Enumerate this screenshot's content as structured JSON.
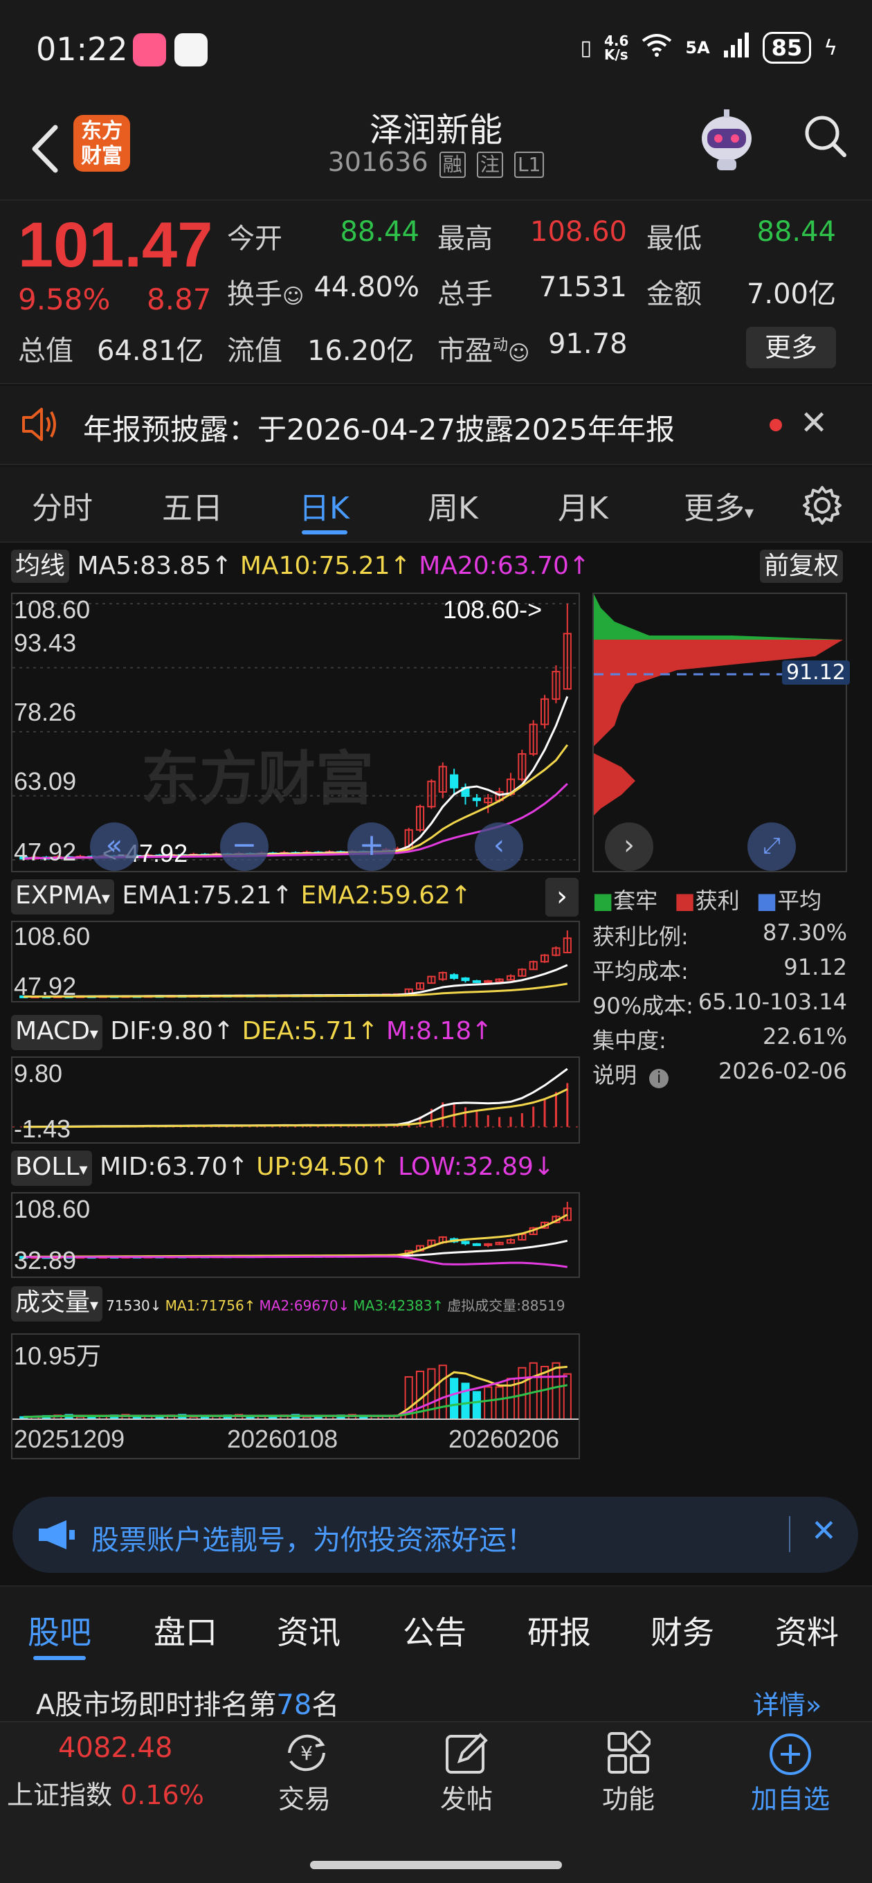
{
  "status_bar": {
    "time": "01:22",
    "network_speed_top": "4.6",
    "network_speed_bottom": "K/s",
    "signal": "5A",
    "battery": "85"
  },
  "header": {
    "logo_line1": "东方",
    "logo_line2": "财富",
    "stock_name": "泽润新能",
    "stock_code": "301636",
    "tags": [
      "融",
      "注",
      "L1"
    ]
  },
  "quote": {
    "price": "101.47",
    "change_pct": "9.58%",
    "change": "8.87",
    "open_label": "今开",
    "open": "88.44",
    "high_label": "最高",
    "high": "108.60",
    "low_label": "最低",
    "low": "88.44",
    "turnover_label": "换手",
    "turnover": "44.80%",
    "volume_label": "总手",
    "volume": "71531",
    "amount_label": "金额",
    "amount": "7.00亿",
    "mktcap_label": "总值",
    "mktcap": "64.81亿",
    "float_label": "流值",
    "float": "16.20亿",
    "pe_label": "市盈",
    "pe_sup": "动",
    "pe": "91.78",
    "more": "更多"
  },
  "notice": {
    "text": "年报预披露：于2026-04-27披露2025年年报"
  },
  "period_tabs": [
    "分时",
    "五日",
    "日K",
    "周K",
    "月K",
    "更多"
  ],
  "active_period": "日K",
  "chart_data": [
    {
      "type": "line",
      "name": "均线",
      "legend": [
        "MA5:83.85↑",
        "MA10:75.21↑",
        "MA20:63.70↑"
      ],
      "adjust": "前复权",
      "ticks_y": [
        "108.60",
        "93.43",
        "78.26",
        "63.09",
        "47.92"
      ],
      "max_marker": "108.60->",
      "min_marker": "<-47.92",
      "ylim": [
        47.92,
        108.6
      ],
      "candles": [
        {
          "o": 48.6,
          "c": 48.2,
          "h": 49.0,
          "l": 47.9
        },
        {
          "o": 48.2,
          "c": 48.5,
          "h": 48.9,
          "l": 48.0
        },
        {
          "o": 48.5,
          "c": 48.3,
          "h": 48.8,
          "l": 48.0
        },
        {
          "o": 48.3,
          "c": 48.6,
          "h": 49.0,
          "l": 48.1
        },
        {
          "o": 48.6,
          "c": 48.4,
          "h": 48.9,
          "l": 48.1
        },
        {
          "o": 48.4,
          "c": 48.7,
          "h": 49.1,
          "l": 48.2
        },
        {
          "o": 48.7,
          "c": 48.5,
          "h": 49.0,
          "l": 48.3
        },
        {
          "o": 48.5,
          "c": 48.8,
          "h": 49.2,
          "l": 48.3
        },
        {
          "o": 48.8,
          "c": 48.6,
          "h": 49.1,
          "l": 48.4
        },
        {
          "o": 48.6,
          "c": 48.9,
          "h": 49.3,
          "l": 48.4
        },
        {
          "o": 48.9,
          "c": 48.7,
          "h": 49.2,
          "l": 48.5
        },
        {
          "o": 48.7,
          "c": 49.0,
          "h": 49.4,
          "l": 48.5
        },
        {
          "o": 49.0,
          "c": 48.8,
          "h": 49.3,
          "l": 48.6
        },
        {
          "o": 48.8,
          "c": 49.1,
          "h": 49.5,
          "l": 48.6
        },
        {
          "o": 49.1,
          "c": 48.9,
          "h": 49.4,
          "l": 48.7
        },
        {
          "o": 48.9,
          "c": 49.2,
          "h": 49.6,
          "l": 48.7
        },
        {
          "o": 49.2,
          "c": 49.0,
          "h": 49.5,
          "l": 48.8
        },
        {
          "o": 49.0,
          "c": 49.3,
          "h": 49.7,
          "l": 48.8
        },
        {
          "o": 49.3,
          "c": 49.1,
          "h": 49.6,
          "l": 48.9
        },
        {
          "o": 49.1,
          "c": 49.4,
          "h": 49.8,
          "l": 48.9
        },
        {
          "o": 49.4,
          "c": 49.2,
          "h": 49.7,
          "l": 49.0
        },
        {
          "o": 49.2,
          "c": 49.5,
          "h": 49.9,
          "l": 49.0
        },
        {
          "o": 49.5,
          "c": 49.3,
          "h": 49.8,
          "l": 49.1
        },
        {
          "o": 49.3,
          "c": 49.6,
          "h": 50.0,
          "l": 49.1
        },
        {
          "o": 49.6,
          "c": 49.4,
          "h": 49.9,
          "l": 49.2
        },
        {
          "o": 49.4,
          "c": 49.7,
          "h": 50.1,
          "l": 49.2
        },
        {
          "o": 49.7,
          "c": 49.5,
          "h": 50.0,
          "l": 49.3
        },
        {
          "o": 49.5,
          "c": 49.8,
          "h": 50.2,
          "l": 49.3
        },
        {
          "o": 49.8,
          "c": 49.6,
          "h": 50.1,
          "l": 49.4
        },
        {
          "o": 49.6,
          "c": 49.9,
          "h": 50.3,
          "l": 49.4
        },
        {
          "o": 49.9,
          "c": 49.7,
          "h": 50.2,
          "l": 49.5
        },
        {
          "o": 49.7,
          "c": 50.0,
          "h": 50.4,
          "l": 49.5
        },
        {
          "o": 50.0,
          "c": 50.3,
          "h": 50.8,
          "l": 49.8
        },
        {
          "o": 50.3,
          "c": 50.5,
          "h": 51.0,
          "l": 50.0
        },
        {
          "o": 50.5,
          "c": 55.0,
          "h": 55.5,
          "l": 50.3
        },
        {
          "o": 55.0,
          "c": 60.5,
          "h": 61.0,
          "l": 54.5
        },
        {
          "o": 60.5,
          "c": 66.5,
          "h": 67.0,
          "l": 60.0
        },
        {
          "o": 64.0,
          "c": 70.0,
          "h": 71.0,
          "l": 62.5
        },
        {
          "o": 68.0,
          "c": 65.0,
          "h": 69.5,
          "l": 63.5
        },
        {
          "o": 65.0,
          "c": 63.0,
          "h": 66.0,
          "l": 61.0
        },
        {
          "o": 62.5,
          "c": 62.0,
          "h": 63.5,
          "l": 60.5
        },
        {
          "o": 61.5,
          "c": 62.5,
          "h": 63.5,
          "l": 59.0
        },
        {
          "o": 62.0,
          "c": 64.0,
          "h": 65.0,
          "l": 61.5
        },
        {
          "o": 63.5,
          "c": 67.0,
          "h": 68.5,
          "l": 63.0
        },
        {
          "o": 67.0,
          "c": 73.0,
          "h": 74.0,
          "l": 66.5
        },
        {
          "o": 73.0,
          "c": 80.0,
          "h": 81.0,
          "l": 72.5
        },
        {
          "o": 80.0,
          "c": 86.0,
          "h": 87.0,
          "l": 79.0
        },
        {
          "o": 86.0,
          "c": 92.5,
          "h": 94.0,
          "l": 85.0
        },
        {
          "o": 88.4,
          "c": 101.5,
          "h": 108.6,
          "l": 88.4
        }
      ]
    },
    {
      "type": "line",
      "name": "EXPMA",
      "legend": [
        "EMA1:75.21↑",
        "EMA2:59.62↑"
      ],
      "ticks_y": [
        "108.60",
        "47.92"
      ]
    },
    {
      "type": "bar",
      "name": "MACD",
      "legend": [
        "DIF:9.80↑",
        "DEA:5.71↑",
        "M:8.18↑"
      ],
      "ticks_y": [
        "9.80",
        "-1.43"
      ],
      "ylim": [
        -1.43,
        9.8
      ]
    },
    {
      "type": "line",
      "name": "BOLL",
      "legend": [
        "MID:63.70↑",
        "UP:94.50↑",
        "LOW:32.89↓"
      ],
      "ticks_y": [
        "108.60",
        "32.89"
      ]
    },
    {
      "type": "bar",
      "name": "成交量",
      "legend": [
        "71530↓",
        "MA1:71756↑",
        "MA2:69670↓",
        "MA3:42383↑",
        "虚拟成交量:88519"
      ],
      "ticks_y": [
        "10.95万"
      ],
      "x_labels": [
        "20251209",
        "20260108",
        "20260206"
      ],
      "ylim": [
        0,
        109500
      ]
    }
  ],
  "chip_panel": {
    "avg_marker": "91.12",
    "legend": [
      "套牢",
      "获利",
      "平均"
    ],
    "rows": [
      {
        "label": "获利比例:",
        "value": "87.30%"
      },
      {
        "label": "平均成本:",
        "value": "91.12"
      },
      {
        "label": "90%成本:",
        "value": "65.10-103.14"
      },
      {
        "label": "集中度:",
        "value": "22.61%"
      }
    ],
    "note_label": "说明",
    "note_date": "2026-02-06"
  },
  "watermark": "东方财富",
  "promo": {
    "text": "股票账户选靓号，为你投资添好运！"
  },
  "bottom_tabs": [
    "股吧",
    "盘口",
    "资讯",
    "公告",
    "研报",
    "财务",
    "资料"
  ],
  "active_bottom_tab": "股吧",
  "ranking": {
    "prefix": "A股市场即时排名第",
    "rank": "78",
    "suffix": "名",
    "details": "详情"
  },
  "nav": {
    "index_value": "4082.48",
    "index_name": "上证指数",
    "index_pct": "0.16%",
    "trade": "交易",
    "post": "发帖",
    "functions": "功能",
    "add_watch": "加自选"
  },
  "colors": {
    "up": "#e8393a",
    "down": "#2fc24b",
    "accent": "#4a9bff",
    "ma5": "#ffffff",
    "ma10": "#f2d64b",
    "ma20": "#e23be0",
    "cyan": "#19e6f0"
  }
}
